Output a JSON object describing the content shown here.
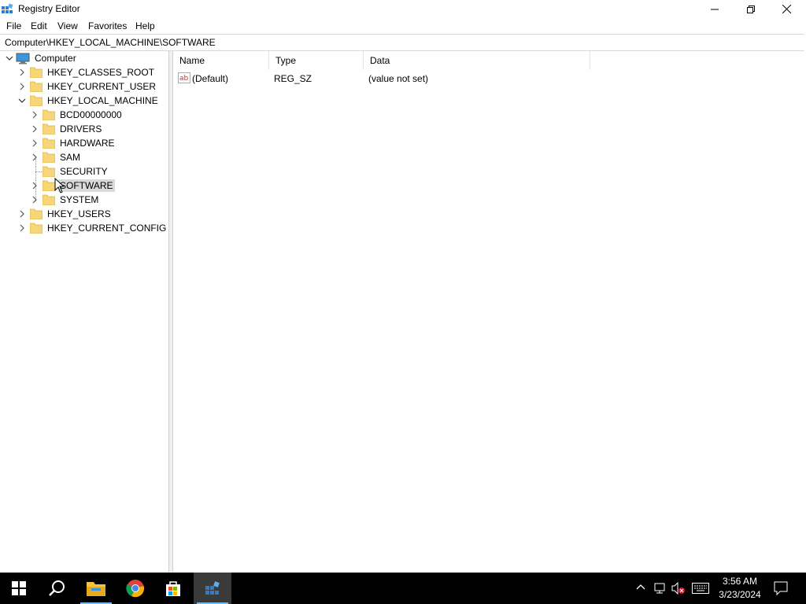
{
  "window": {
    "title": "Registry Editor"
  },
  "menu": {
    "items": [
      "File",
      "Edit",
      "View",
      "Favorites",
      "Help"
    ]
  },
  "address": {
    "path": "Computer\\HKEY_LOCAL_MACHINE\\SOFTWARE"
  },
  "tree": {
    "root": "Computer",
    "items": [
      {
        "label": "HKEY_CLASSES_ROOT"
      },
      {
        "label": "HKEY_CURRENT_USER"
      },
      {
        "label": "HKEY_LOCAL_MACHINE"
      },
      {
        "label": "BCD00000000"
      },
      {
        "label": "DRIVERS"
      },
      {
        "label": "HARDWARE"
      },
      {
        "label": "SAM"
      },
      {
        "label": "SECURITY"
      },
      {
        "label": "SOFTWARE"
      },
      {
        "label": "SYSTEM"
      },
      {
        "label": "HKEY_USERS"
      },
      {
        "label": "HKEY_CURRENT_CONFIG"
      }
    ],
    "selected": "SOFTWARE"
  },
  "list": {
    "columns": [
      "Name",
      "Type",
      "Data"
    ],
    "rows": [
      {
        "name": "(Default)",
        "type": "REG_SZ",
        "data": "(value not set)"
      }
    ]
  },
  "taskbar": {
    "apps": [
      "start-icon",
      "search-icon",
      "file-explorer-icon",
      "chrome-icon",
      "store-icon",
      "registry-editor-icon"
    ],
    "time": "3:56 AM",
    "date": "3/23/2024"
  },
  "colors": {
    "folder": "#f5d67a",
    "accent": "#0078d7",
    "taskbar": "#000000"
  }
}
